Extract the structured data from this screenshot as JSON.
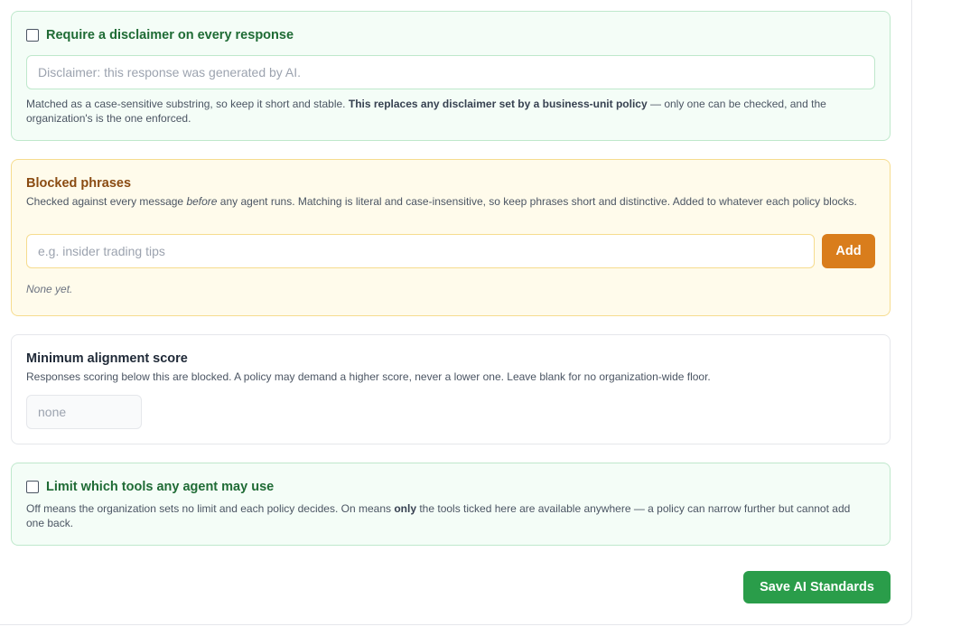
{
  "disclaimer": {
    "checkbox_label": "Require a disclaimer on every response",
    "input_placeholder": "Disclaimer: this response was generated by AI.",
    "help_pre": "Matched as a case-sensitive substring, so keep it short and stable. ",
    "help_bold": "This replaces any disclaimer set by a business-unit policy",
    "help_post": " — only one can be checked, and the organization's is the one enforced."
  },
  "blocked": {
    "title": "Blocked phrases",
    "help_pre": "Checked against every message ",
    "help_em": "before",
    "help_post": " any agent runs. Matching is literal and case-insensitive, so keep phrases short and distinctive. Added to whatever each policy blocks.",
    "input_placeholder": "e.g. insider trading tips",
    "add_label": "Add",
    "empty_text": "None yet."
  },
  "alignment": {
    "title": "Minimum alignment score",
    "help": "Responses scoring below this are blocked. A policy may demand a higher score, never a lower one. Leave blank for no organization-wide floor.",
    "input_placeholder": "none"
  },
  "tools": {
    "checkbox_label": "Limit which tools any agent may use",
    "help_pre": "Off means the organization sets no limit and each policy decides. On means ",
    "help_bold": "only",
    "help_post": " the tools ticked here are available anywhere — a policy can narrow further but cannot add one back."
  },
  "save_label": "Save AI Standards",
  "colors": {
    "green_accent": "#1f6b35",
    "amber_accent": "#8a4b12",
    "add_button": "#d97d1c",
    "save_button": "#2a9d4a"
  }
}
